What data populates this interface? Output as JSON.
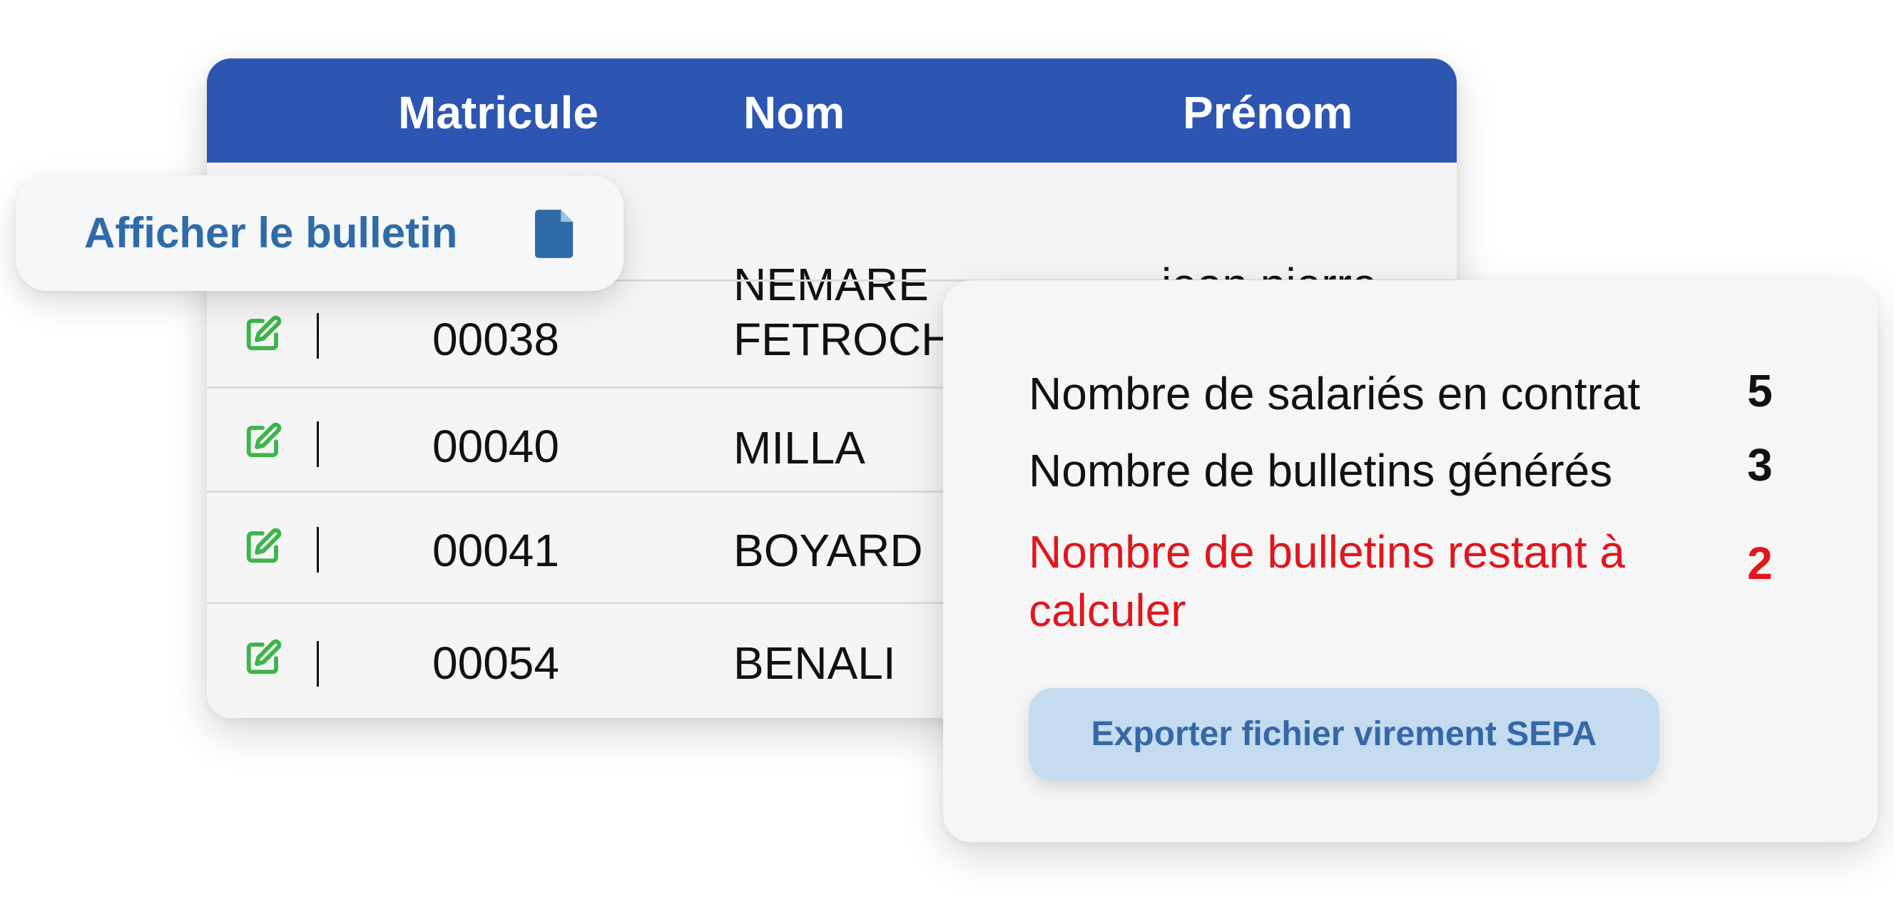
{
  "table": {
    "columns": {
      "matricule": "Matricule",
      "nom": "Nom",
      "prenom": "Prénom"
    },
    "rows": [
      {
        "matricule": "",
        "nom": "NEMARE",
        "prenom": "jean pierre"
      },
      {
        "matricule": "00038",
        "nom": "FETROCH",
        "prenom": ""
      },
      {
        "matricule": "00040",
        "nom": "MILLA",
        "prenom": ""
      },
      {
        "matricule": "00041",
        "nom": "BOYARD",
        "prenom": ""
      },
      {
        "matricule": "00054",
        "nom": "BENALI",
        "prenom": ""
      }
    ]
  },
  "row_action": {
    "label": "Afficher le bulletin",
    "icon": "document-icon"
  },
  "icons": {
    "row_edit": "edit-icon",
    "row_separator": "|"
  },
  "summary": {
    "employees_label": "Nombre de salariés en contrat",
    "employees_count": "5",
    "payslips_generated_label": "Nombre de bulletins générés",
    "payslips_generated_count": "3",
    "payslips_remaining_label": "Nombre de bulletins restant à calculer",
    "payslips_remaining_count": "2",
    "export_button": "Exporter fichier virement SEPA"
  },
  "colors": {
    "header": "#2d55b2",
    "link": "#2e6ba8",
    "edit_icon": "#3cb54a",
    "warning": "#e0161e",
    "export_button_bg": "#c5dbef"
  }
}
